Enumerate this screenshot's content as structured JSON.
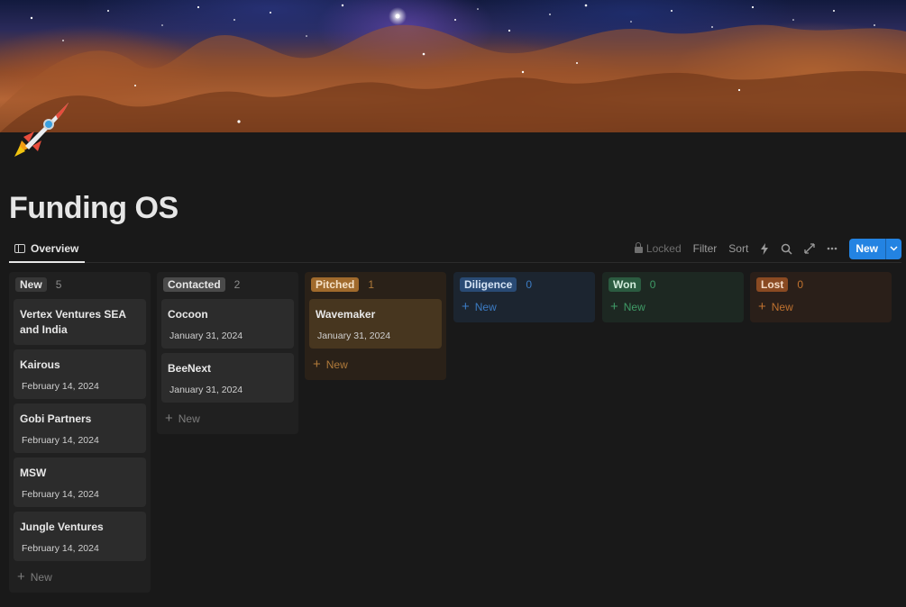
{
  "page": {
    "title": "Funding OS"
  },
  "tabs": [
    {
      "label": "Overview"
    }
  ],
  "toolbar": {
    "locked": "Locked",
    "filter": "Filter",
    "sort": "Sort",
    "new": "New"
  },
  "colors": {
    "accent": "#2383e2",
    "background": "#191919"
  },
  "columns": [
    {
      "name": "New",
      "count": "5",
      "add": "New",
      "cards": [
        {
          "title": "Vertex Ventures SEA and India",
          "date": ""
        },
        {
          "title": "Kairous",
          "date": "February 14, 2024"
        },
        {
          "title": "Gobi Partners",
          "date": "February 14, 2024"
        },
        {
          "title": "MSW",
          "date": "February 14, 2024"
        },
        {
          "title": "Jungle Ventures",
          "date": "February 14, 2024"
        }
      ]
    },
    {
      "name": "Contacted",
      "count": "2",
      "add": "New",
      "cards": [
        {
          "title": "Cocoon",
          "date": "January 31, 2024"
        },
        {
          "title": "BeeNext",
          "date": "January 31, 2024"
        }
      ]
    },
    {
      "name": "Pitched",
      "count": "1",
      "add": "New",
      "cards": [
        {
          "title": "Wavemaker",
          "date": "January 31, 2024"
        }
      ]
    },
    {
      "name": "Diligence",
      "count": "0",
      "add": "New",
      "cards": []
    },
    {
      "name": "Won",
      "count": "0",
      "add": "New",
      "cards": []
    },
    {
      "name": "Lost",
      "count": "0",
      "add": "New",
      "cards": []
    }
  ]
}
